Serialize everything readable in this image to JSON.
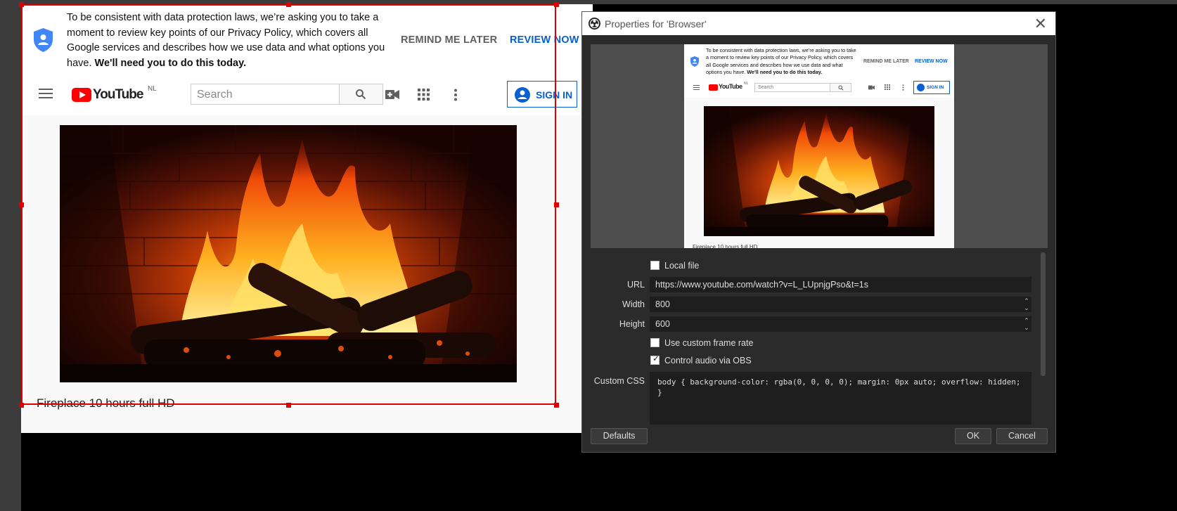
{
  "consent": {
    "text": "To be consistent with data protection laws, we’re asking you to take a moment to review key points of our Privacy Policy, which covers all Google services and describes how we use data and what options you have.",
    "bold": "We'll need you to do this today.",
    "remind_label": "REMIND ME LATER",
    "review_label": "REVIEW NOW"
  },
  "youtube": {
    "logo_text": "YouTube",
    "region": "NL",
    "search_placeholder": "Search",
    "signin_label": "SIGN IN",
    "video_title": "Fireplace 10 hours full HD"
  },
  "dialog": {
    "title": "Properties for 'Browser'",
    "local_file_label": "Local file",
    "url_label": "URL",
    "url_value": "https://www.youtube.com/watch?v=L_LUpnjgPso&t=1s",
    "width_label": "Width",
    "width_value": "800",
    "height_label": "Height",
    "height_value": "600",
    "custom_fps_label": "Use custom frame rate",
    "control_audio_label": "Control audio via OBS",
    "custom_css_label": "Custom CSS",
    "custom_css_value": "body { background-color: rgba(0, 0, 0, 0); margin: 0px auto; overflow: hidden;  }",
    "defaults_label": "Defaults",
    "ok_label": "OK",
    "cancel_label": "Cancel",
    "control_audio_checked": true
  },
  "colors": {
    "accent_blue": "#065fd4",
    "selection_red": "#e00000"
  }
}
